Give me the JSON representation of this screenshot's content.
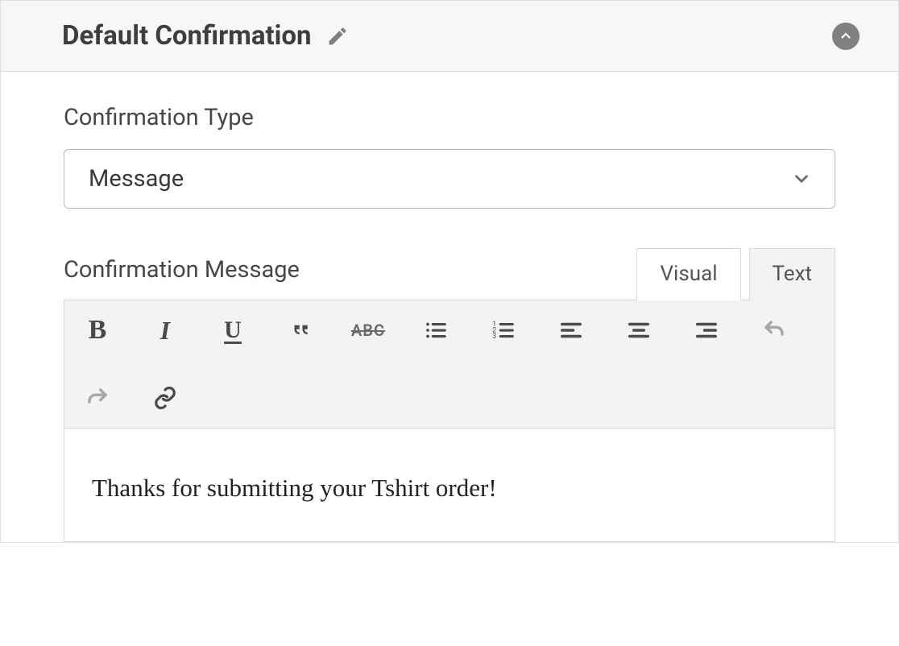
{
  "header": {
    "title": "Default Confirmation"
  },
  "confirmation_type": {
    "label": "Confirmation Type",
    "selected": "Message"
  },
  "message": {
    "label": "Confirmation Message",
    "tabs": {
      "visual": "Visual",
      "text": "Text",
      "active": "visual"
    },
    "toolbar": {
      "bold": "B",
      "italic": "I",
      "underline": "U",
      "strike": "ABC"
    },
    "content": "Thanks for submitting your Tshirt order!"
  }
}
